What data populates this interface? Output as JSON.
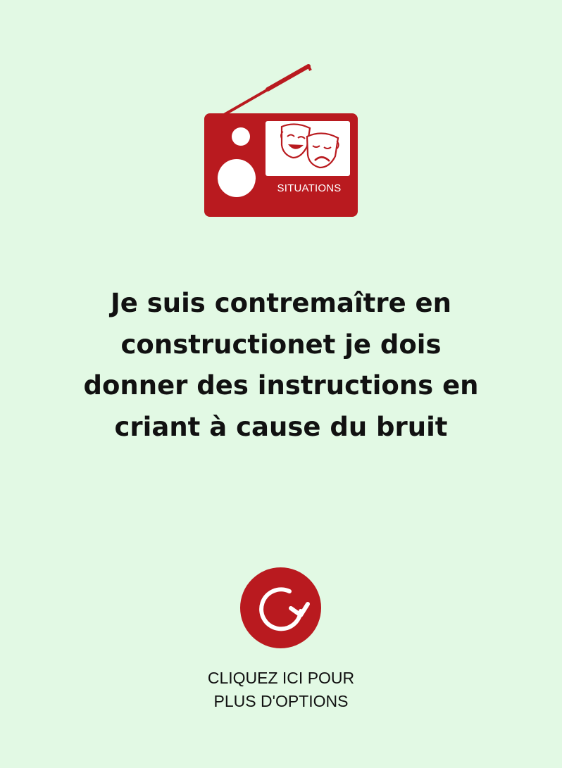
{
  "logo": {
    "label": "SITUATIONS",
    "icon": "radio-with-theater-masks",
    "color": "#b91a1f"
  },
  "situation": {
    "text": "Je suis contremaître en\nconstructionet je dois\ndonner des instructions en\ncriant à cause du bruit"
  },
  "options": {
    "icon": "refresh-icon",
    "caption": "CLIQUEZ ICI POUR\nPLUS D'OPTIONS",
    "color": "#b91a1f"
  },
  "colors": {
    "background": "#e2f9e4",
    "accent": "#b91a1f",
    "text": "#111111"
  }
}
